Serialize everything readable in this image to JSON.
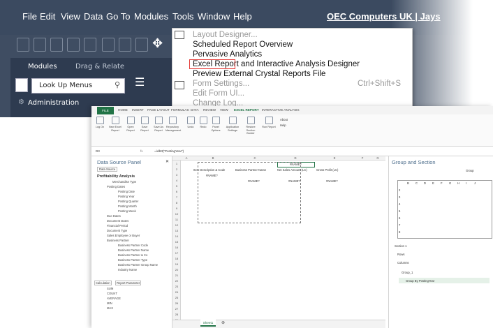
{
  "menu": [
    "File",
    "Edit",
    "View",
    "Data",
    "Go To",
    "Modules",
    "Tools",
    "Window",
    "Help"
  ],
  "company": "OEC Computers UK | Jays",
  "modules": {
    "tab1": "Modules",
    "tab2": "Drag & Relate",
    "lookup": "Look Up Menus",
    "admin": "Administration"
  },
  "tools": {
    "items": [
      "Layout Designer...",
      "Scheduled Report Overview",
      "Pervasive Analytics",
      "Excel Report and Interactive Analysis Designer",
      "Preview External Crystal Reports File",
      "Form Settings...",
      "Edit Form UI...",
      "Change Log..."
    ],
    "shortcut": "Ctrl+Shift+S"
  },
  "excel": {
    "tabs": [
      "FILE",
      "HOME",
      "INSERT",
      "PAGE LAYOUT",
      "FORMULAS",
      "DATA",
      "REVIEW",
      "VIEW",
      "EXCEL REPORT",
      "INTERACTIVE ANALYSIS"
    ],
    "ribbon": [
      "Log On",
      "New Excel Report",
      "Open Report",
      "Save Report",
      "Save As Report",
      "Repository Management",
      "Undo",
      "Redo",
      "Panel Options",
      "Application Settings",
      "Restore Section Border",
      "Run Report",
      "About",
      "Help"
    ],
    "namebox": "D3",
    "fx": "fx",
    "formula": "=ixlbtt(\"PostingYear\")",
    "dsp": {
      "title": "Data Source Panel",
      "tab": "Data Source",
      "heading": "Profitability Analysis",
      "tree": [
        "Merchandise Type",
        "Posting Dates",
        "Posting Date",
        "Posting Year",
        "Posting Quarter",
        "Posting Month",
        "Posting Week",
        "Due Dates",
        "Document Dates",
        "Financial Period",
        "Document Type",
        "Sales Employee or Buyer",
        "Business Partner",
        "Business Partner Code",
        "Business Partner Name",
        "Business Partner & Co",
        "Business Partner Type",
        "Business Partner Group Name",
        "Industry Name"
      ],
      "calc_tab": "Calculation",
      "param_tab": "Report Parameter",
      "funcs": [
        "SUM",
        "COUNT",
        "AVERAGE",
        "MIN",
        "MAX"
      ]
    },
    "cols": [
      "A",
      "B",
      "C",
      "D",
      "E",
      "F",
      "G"
    ],
    "rows": [
      "1",
      "2",
      "3",
      "4",
      "5",
      "6",
      "7",
      "8",
      "9",
      "10",
      "11",
      "12",
      "13",
      "14",
      "15",
      "16",
      "17",
      "18",
      "19",
      "20",
      "21",
      "22",
      "23",
      "24",
      "25",
      "26",
      "27",
      "28",
      "29",
      "30"
    ],
    "cells": {
      "d2": "#NAME?",
      "h1": "Item Description & Code",
      "h2": "Business Partner Name",
      "h3": "Net Sales Amount (LC)",
      "h4": "Gross Profit (LC)",
      "b4": "#NAME?",
      "c5": "#NAME?",
      "d5": "#NAME?",
      "e5": "#NAME?"
    },
    "sheet": "Sheet1",
    "gsp": {
      "title": "Group and Section",
      "group_btn": "Group",
      "mini_cols": [
        "B",
        "C",
        "D",
        "E",
        "F",
        "G",
        "H",
        "I",
        "J"
      ],
      "mini_rows": [
        "2",
        "3",
        "4",
        "5",
        "6",
        "7",
        "8"
      ],
      "section": "Section 1",
      "rows": "Rows",
      "columns": "Columns",
      "group1": "Group_1",
      "groupby": "Group By PostingYear"
    }
  }
}
